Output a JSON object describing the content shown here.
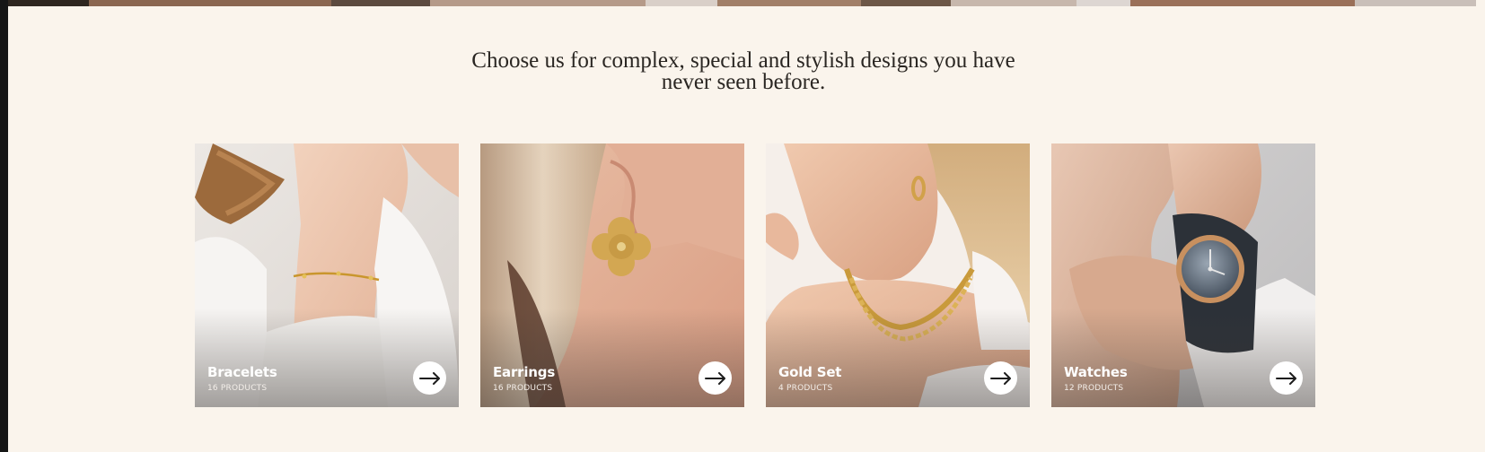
{
  "colors": {
    "background": "#faf4ec",
    "heading": "#2a2622",
    "card_text": "#ffffff",
    "arrow_button": "#ffffff"
  },
  "headline": "Choose us for complex, special and stylish designs you have never seen before.",
  "categories": [
    {
      "title": "Bracelets",
      "count": "16 PRODUCTS",
      "icon": "arrow-right-icon"
    },
    {
      "title": "Earrings",
      "count": "16 PRODUCTS",
      "icon": "arrow-right-icon"
    },
    {
      "title": "Gold Set",
      "count": "4 PRODUCTS",
      "icon": "arrow-right-icon"
    },
    {
      "title": "Watches",
      "count": "12 PRODUCTS",
      "icon": "arrow-right-icon"
    }
  ]
}
